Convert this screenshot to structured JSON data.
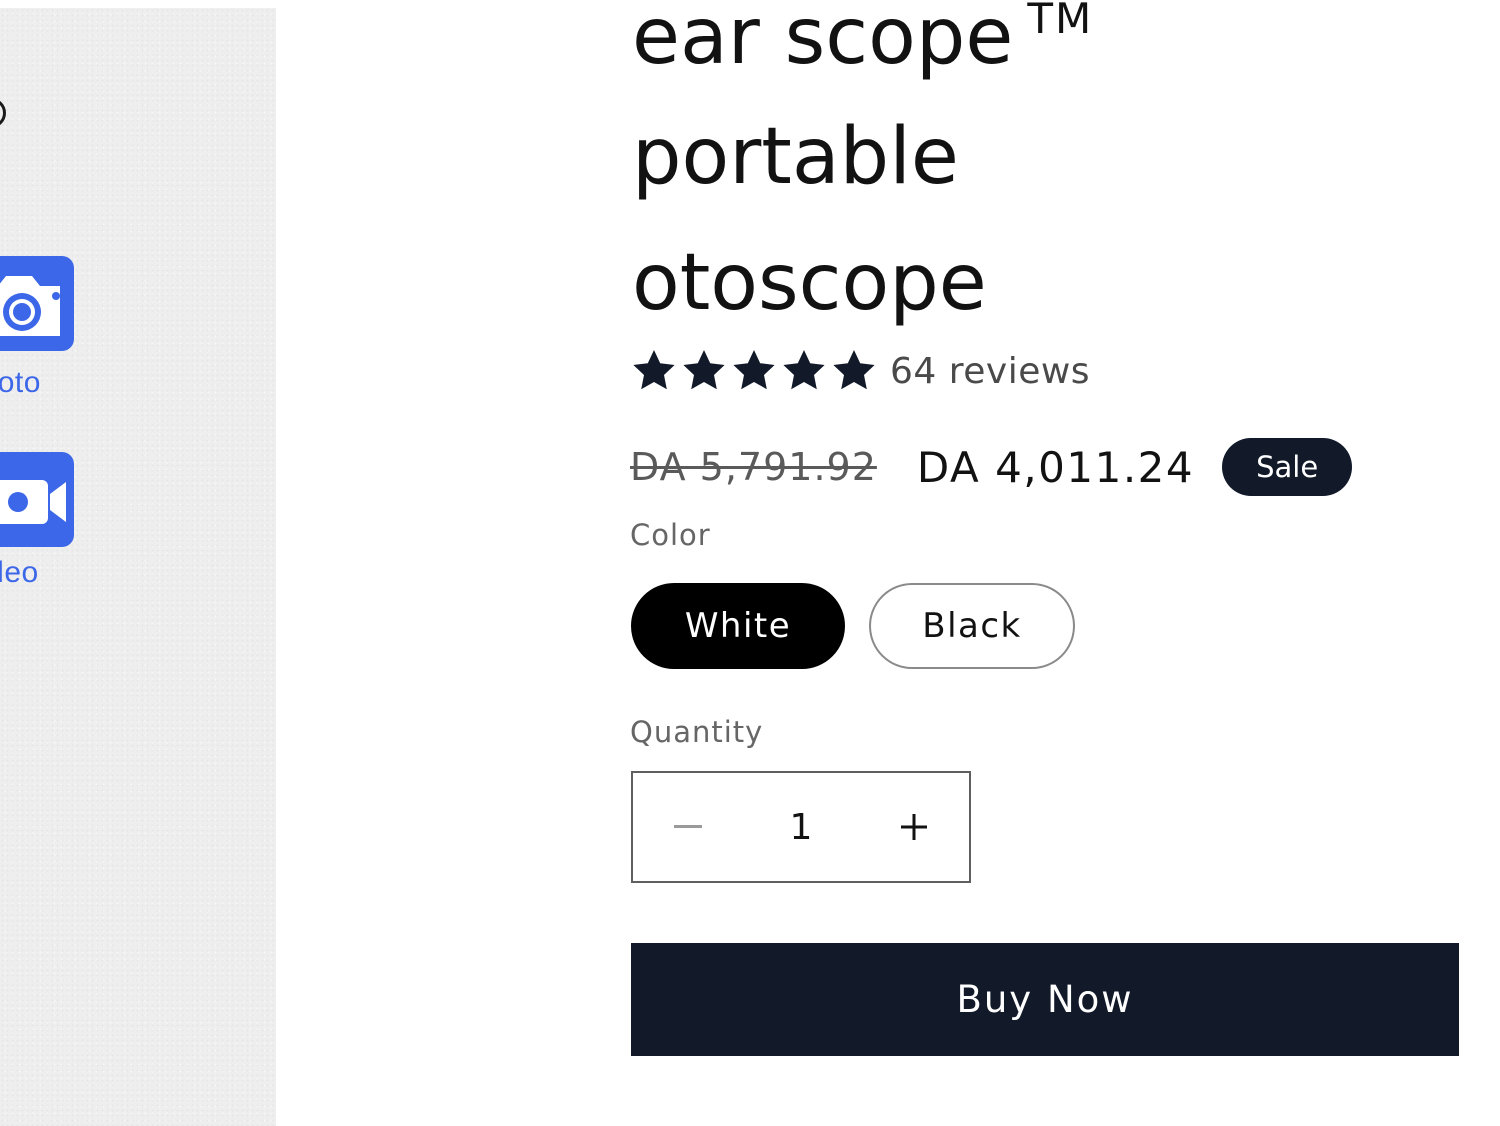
{
  "media_panel": {
    "photo_label": "Photo",
    "video_label": "Video",
    "accent_color": "#3c67e8"
  },
  "product": {
    "title_lines": [
      "ear scope",
      "portable",
      "otoscope"
    ],
    "trademark": "TM",
    "rating": {
      "stars": 5,
      "max_stars": 5,
      "count_label": "64 reviews"
    },
    "price": {
      "compare_at": "DA 5,791.92",
      "current": "DA 4,011.24",
      "badge": "Sale"
    },
    "color": {
      "label": "Color",
      "options": [
        "White",
        "Black"
      ],
      "selected": "White"
    },
    "quantity": {
      "label": "Quantity",
      "value": "1",
      "decrement_icon": "minus-icon",
      "increment_icon": "plus-icon"
    },
    "buy_now_label": "Buy Now"
  },
  "colors": {
    "primary_dark": "#121a2a",
    "text": "#121212",
    "muted": "#666666"
  }
}
